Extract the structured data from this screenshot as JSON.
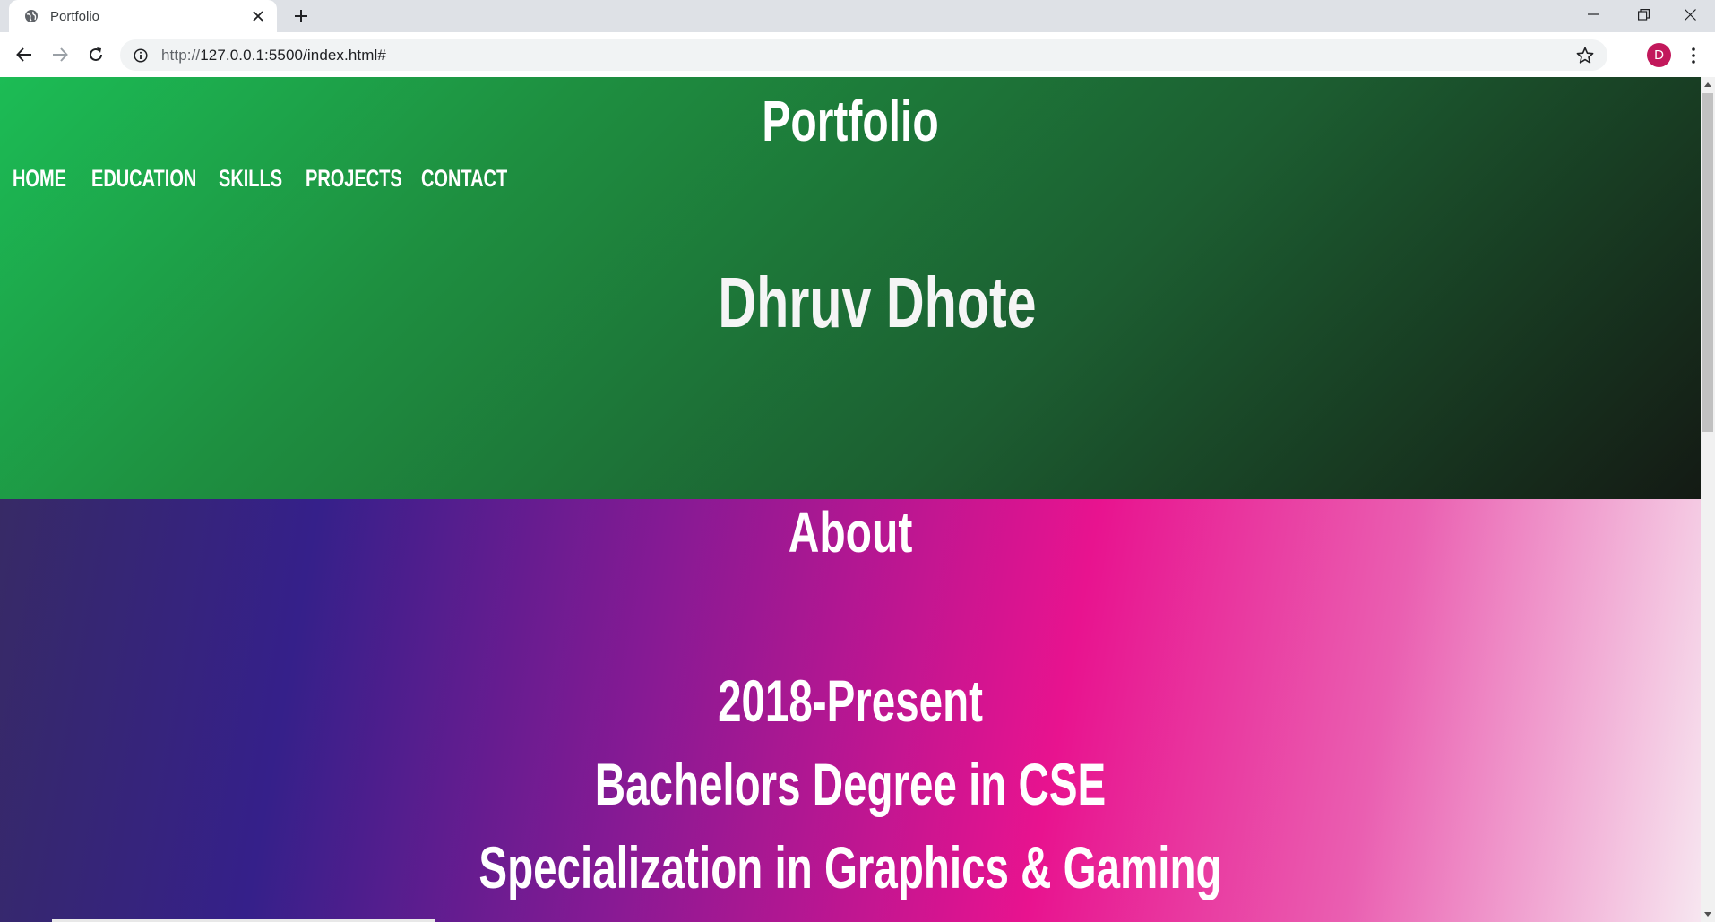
{
  "browser": {
    "tab_title": "Portfolio",
    "url_scheme": "http://",
    "url_rest": "127.0.0.1:5500/index.html#",
    "profile_initial": "D",
    "icons": [
      "globe-icon",
      "close-icon",
      "plus-icon",
      "minimize-icon",
      "restore-icon",
      "window-close-icon",
      "back-icon",
      "forward-icon",
      "reload-icon",
      "info-icon",
      "star-icon",
      "kebab-menu-icon"
    ]
  },
  "header": {
    "site_title": "Portfolio",
    "nav": [
      "HOME",
      "EDUCATION",
      "SKILLS",
      "PROJECTS",
      "CONTACT"
    ]
  },
  "hero": {
    "name": "Dhruv Dhote"
  },
  "about": {
    "title": "About",
    "lines": [
      "2018-Present",
      "Bachelors Degree in CSE",
      "Specialization in Graphics & Gaming"
    ]
  },
  "colors": {
    "hero_gradient": [
      "#1cbc55",
      "#1e8f40",
      "#1c5e31",
      "#141a14"
    ],
    "about_gradient": [
      "#372a66",
      "#35208a",
      "#861a94",
      "#e8138f",
      "#ea5fb1",
      "#f7e6f0"
    ]
  }
}
